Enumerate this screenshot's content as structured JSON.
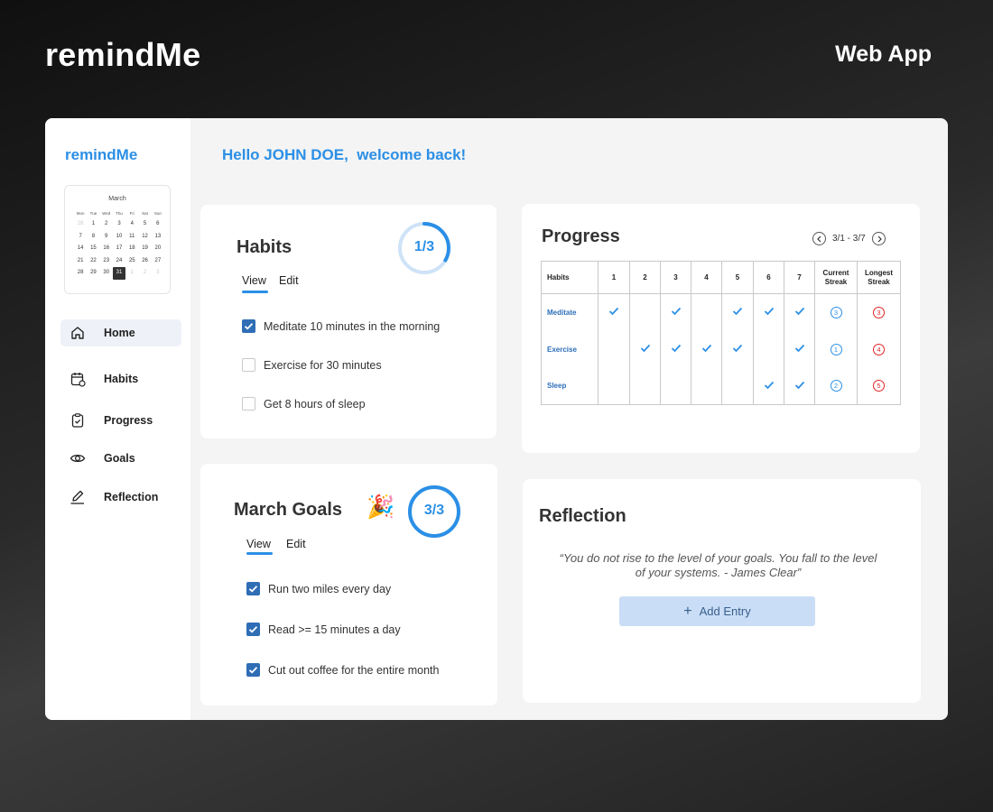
{
  "header": {
    "brand": "remindMe",
    "tag": "Web App"
  },
  "sidebar": {
    "brand": "remindMe",
    "calendar": {
      "month": "March",
      "day_names": [
        "Mon",
        "Tue",
        "Wed",
        "Thu",
        "Fri",
        "Sat",
        "Sun"
      ],
      "rows": [
        [
          "28",
          "1",
          "2",
          "3",
          "4",
          "5",
          "6"
        ],
        [
          "7",
          "8",
          "9",
          "10",
          "11",
          "12",
          "13"
        ],
        [
          "14",
          "15",
          "16",
          "17",
          "18",
          "19",
          "20"
        ],
        [
          "21",
          "22",
          "23",
          "24",
          "25",
          "26",
          "27"
        ],
        [
          "28",
          "29",
          "30",
          "31",
          "1",
          "2",
          "3"
        ]
      ],
      "selected": "31"
    },
    "items": [
      {
        "label": "Home",
        "icon": "home-icon",
        "active": true
      },
      {
        "label": "Habits",
        "icon": "calendar-icon",
        "active": false
      },
      {
        "label": "Progress",
        "icon": "clipboard-check-icon",
        "active": false
      },
      {
        "label": "Goals",
        "icon": "eye-icon",
        "active": false
      },
      {
        "label": "Reflection",
        "icon": "pencil-icon",
        "active": false
      }
    ]
  },
  "greeting": {
    "prefix": "Hello ",
    "name": "JOHN DOE,",
    "suffix": "  welcome back!"
  },
  "habits": {
    "title": "Habits",
    "counter": "1/3",
    "progress": 0.3333,
    "tabs": {
      "view": "View",
      "edit": "Edit"
    },
    "items": [
      {
        "label": "Meditate 10 minutes in the morning",
        "checked": true
      },
      {
        "label": "Exercise for 30 minutes",
        "checked": false
      },
      {
        "label": "Get 8 hours of sleep",
        "checked": false
      }
    ]
  },
  "goals": {
    "title": "March Goals",
    "emoji": "🎉",
    "counter": "3/3",
    "progress": 1.0,
    "tabs": {
      "view": "View",
      "edit": "Edit"
    },
    "items": [
      {
        "label": "Run two miles every day",
        "checked": true
      },
      {
        "label": "Read >= 15 minutes a day",
        "checked": true
      },
      {
        "label": "Cut out coffee for the entire month",
        "checked": true
      }
    ]
  },
  "progress": {
    "title": "Progress",
    "range": "3/1 - 3/7",
    "columns": {
      "habits": "Habits",
      "days": [
        "1",
        "2",
        "3",
        "4",
        "5",
        "6",
        "7"
      ],
      "current_line1": "Current",
      "current_line2": "Streak",
      "longest_line1": "Longest",
      "longest_line2": "Streak"
    },
    "rows": [
      {
        "name": "Meditate",
        "days": [
          true,
          false,
          true,
          false,
          true,
          true,
          true
        ],
        "current": "3",
        "longest": "3"
      },
      {
        "name": "Exercise",
        "days": [
          false,
          true,
          true,
          true,
          true,
          false,
          true
        ],
        "current": "1",
        "longest": "4"
      },
      {
        "name": "Sleep",
        "days": [
          false,
          false,
          false,
          false,
          false,
          true,
          true
        ],
        "current": "2",
        "longest": "5"
      }
    ]
  },
  "reflection": {
    "title": "Reflection",
    "quote": "“You do not rise to the level of your goals. You fall to the level of your systems. - James Clear”",
    "add_label": "Add Entry"
  },
  "colors": {
    "accent": "#2b8fe6",
    "checkbox": "#2f6db5",
    "longest": "#e02424",
    "button_bg": "#c9def6"
  }
}
